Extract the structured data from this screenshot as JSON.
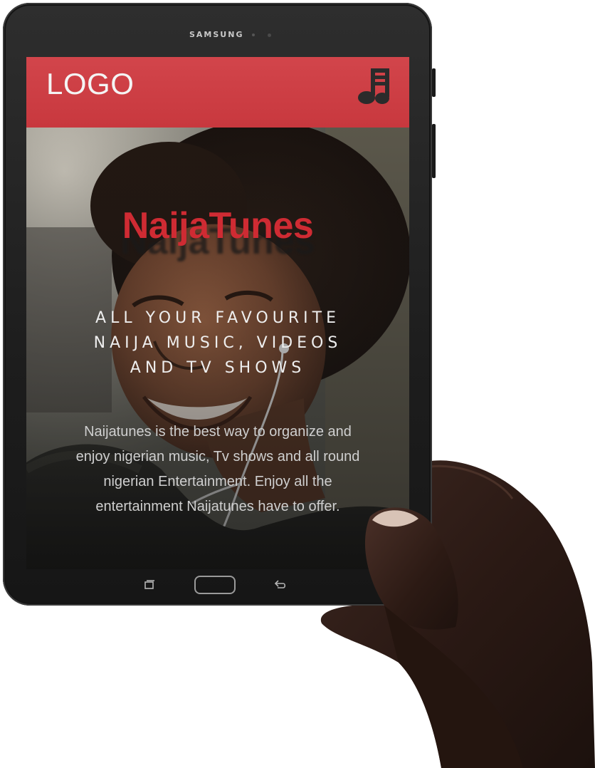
{
  "device": {
    "brand": "SAMSUNG"
  },
  "app": {
    "logo": "LOGO",
    "header_icon": "music-note-icon",
    "brand_name": "NaijaTunes",
    "tagline": "ALL YOUR FAVOURITE NAIJA MUSIC, VIDEOS AND TV SHOWS",
    "description": "Naijatunes is the best way to organize and enjoy nigerian music, Tv shows and all round nigerian Entertainment. Enjoy all the entertainment Naijatunes have to offer."
  },
  "navigation": {
    "recents": "recents-icon",
    "home": "home-button",
    "back": "back-icon"
  },
  "colors": {
    "header": "#c8383e",
    "brand_text": "#cf2b33",
    "device_body": "#1d1d1d"
  }
}
